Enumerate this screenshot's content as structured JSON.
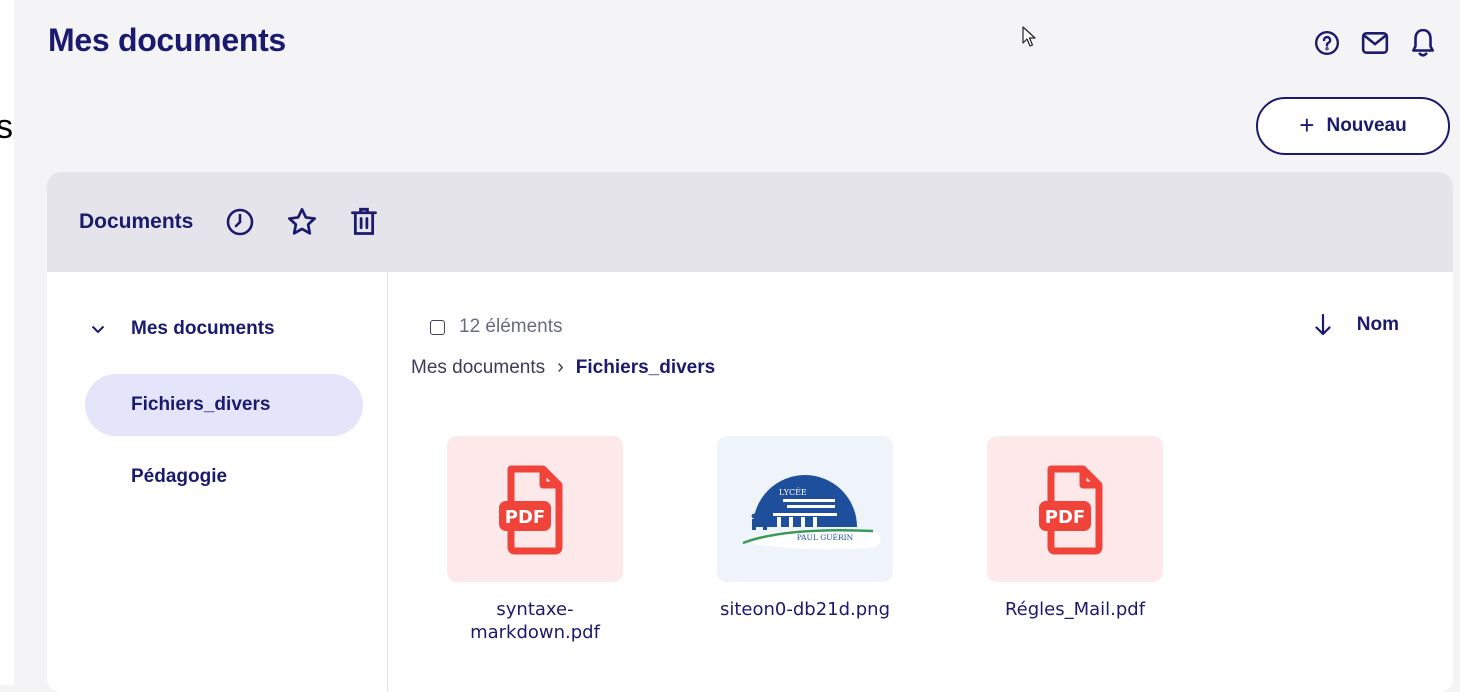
{
  "left_fragment": "s",
  "page": {
    "title": "Mes documents"
  },
  "header_icons": [
    "help-icon",
    "mail-icon",
    "bell-icon"
  ],
  "new_button": {
    "label": "Nouveau"
  },
  "toolbar": {
    "title": "Documents",
    "icons": [
      "recent-icon",
      "favorites-star-icon",
      "trash-icon"
    ]
  },
  "sidebar": {
    "root": {
      "label": "Mes documents",
      "expanded": true
    },
    "items": [
      {
        "label": "Fichiers_divers",
        "active": true
      },
      {
        "label": "Pédagogie",
        "active": false
      }
    ]
  },
  "listing": {
    "count_label": "12 éléments",
    "sort_label": "Nom",
    "breadcrumb": [
      "Mes documents",
      "Fichiers_divers"
    ],
    "files": [
      {
        "name": "syntaxe-markdown.pdf",
        "type": "pdf"
      },
      {
        "name": "siteon0-db21d.png",
        "type": "image"
      },
      {
        "name": "Régles_Mail.pdf",
        "type": "pdf"
      }
    ]
  },
  "logo": {
    "line1": "LYCÉE",
    "line2": "PAUL GUÉRIN"
  },
  "pdf_badge": "PDF",
  "colors": {
    "accent": "#1a1a6e",
    "pdf_red": "#f0433a",
    "active_item_bg": "#e4e4fa",
    "toolbar_bg": "#e4e4ea"
  }
}
